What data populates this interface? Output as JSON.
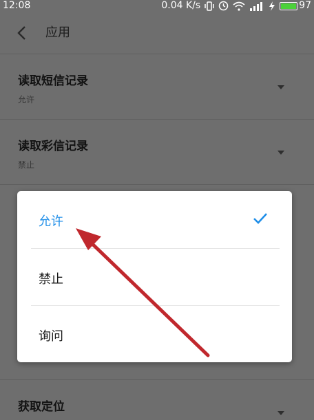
{
  "status_bar": {
    "time": "12:08",
    "speed": "0.04 K/s",
    "battery": "97",
    "icons": [
      "vibrate-icon",
      "alarm-icon",
      "wifi-icon",
      "signal-icon",
      "charging-icon",
      "battery-icon"
    ]
  },
  "header": {
    "title": "应用",
    "back_icon": "chevron-left-icon"
  },
  "rows": [
    {
      "title": "读取短信记录",
      "value": "允许"
    },
    {
      "title": "读取彩信记录",
      "value": "禁止"
    },
    {
      "title": "获取定位",
      "value": ""
    }
  ],
  "dialog": {
    "options": [
      {
        "label": "允许",
        "selected": true
      },
      {
        "label": "禁止",
        "selected": false
      },
      {
        "label": "询问",
        "selected": false
      }
    ]
  },
  "colors": {
    "accent": "#1f8ee8",
    "overlay_bg": "#6e6e6e",
    "arrow": "#c0282d",
    "battery": "#4cd13a"
  }
}
